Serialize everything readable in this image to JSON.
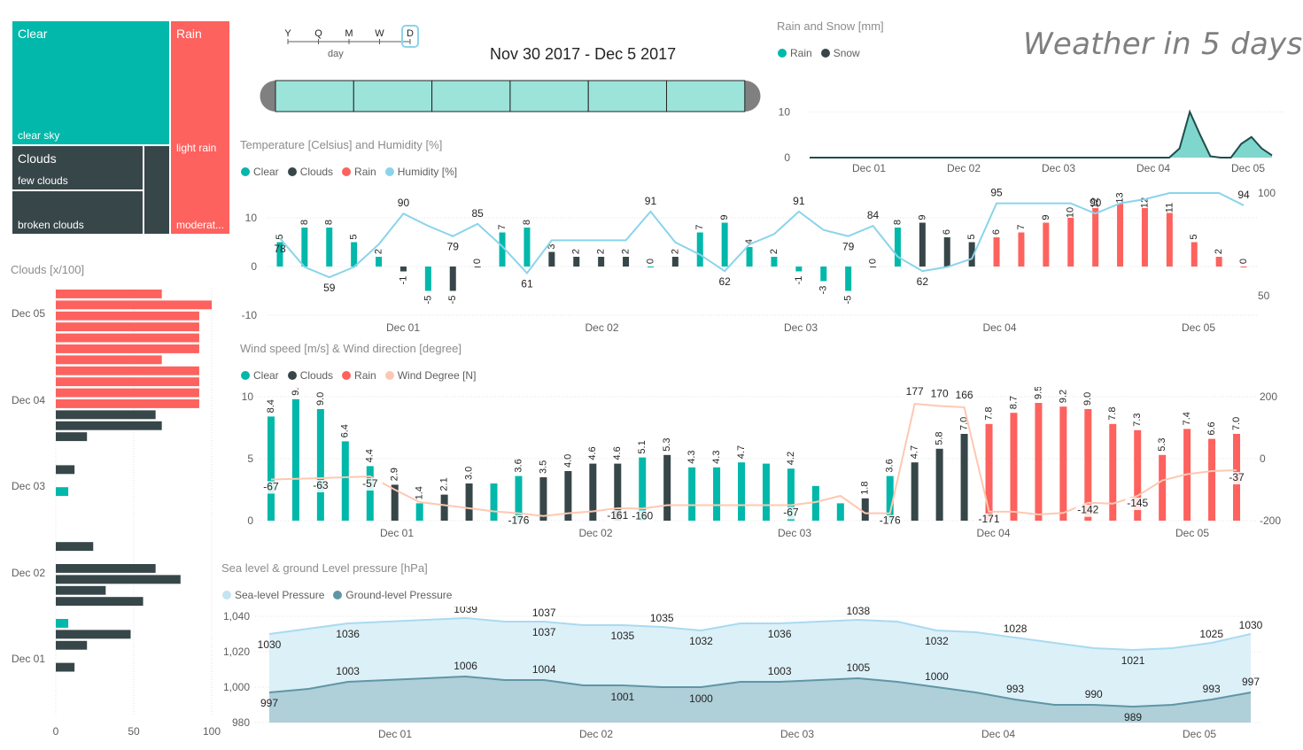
{
  "colors": {
    "clear": "#01b8aa",
    "clouds": "#374649",
    "rain": "#fd625e",
    "humidity": "#8ad4eb",
    "wind": "#fdc8b2",
    "sea": "#c4e4f3",
    "ground": "#5f96a6"
  },
  "header": {
    "title": "Weather in 5 days",
    "date_range": "Nov 30 2017 - Dec 5 2017",
    "slicer": {
      "levels": [
        "Y",
        "Q",
        "M",
        "W",
        "D"
      ],
      "selected": "D",
      "caption": "day"
    }
  },
  "treemap": {
    "clear": {
      "label": "Clear",
      "sub": "clear sky"
    },
    "rain": {
      "label": "Rain",
      "sub1": "light rain",
      "sub2": "moderat..."
    },
    "clouds": {
      "label": "Clouds",
      "sub1": "few clouds",
      "sub2": "broken clouds"
    }
  },
  "rain_snow": {
    "title": "Rain and Snow [mm]",
    "legend": [
      "Rain",
      "Snow"
    ],
    "y_ticks": [
      "10",
      "0"
    ],
    "x_ticks": [
      "Dec 01",
      "Dec 02",
      "Dec 03",
      "Dec 04",
      "Dec 05"
    ]
  },
  "temp": {
    "title": "Temperature [Celsius] and Humidity [%]",
    "legend": [
      "Clear",
      "Clouds",
      "Rain",
      "Humidity [%]"
    ],
    "y_left": [
      "10",
      "0",
      "-10"
    ],
    "y_right": [
      "100",
      "50"
    ],
    "x_ticks": [
      "Dec 01",
      "Dec 02",
      "Dec 03",
      "Dec 04",
      "Dec 05"
    ]
  },
  "wind": {
    "title": "Wind speed [m/s] & Wind direction [degree]",
    "legend": [
      "Clear",
      "Clouds",
      "Rain",
      "Wind Degree [N]"
    ],
    "y_left": [
      "10",
      "5",
      "0"
    ],
    "y_right": [
      "200",
      "0",
      "-200"
    ],
    "x_ticks": [
      "Dec 01",
      "Dec 02",
      "Dec 03",
      "Dec 04",
      "Dec 05"
    ]
  },
  "pressure": {
    "title": "Sea level & ground Level pressure [hPa]",
    "legend": [
      "Sea-level Pressure",
      "Ground-level Pressure"
    ],
    "y_ticks": [
      "1,040",
      "1,020",
      "1,000",
      "980"
    ],
    "x_ticks": [
      "Dec 01",
      "Dec 02",
      "Dec 03",
      "Dec 04",
      "Dec 05"
    ]
  },
  "clouds_bar": {
    "title": "Clouds [x/100]",
    "x_ticks": [
      "0",
      "50",
      "100"
    ],
    "y_ticks": [
      "Dec 05",
      "Dec 04",
      "Dec 03",
      "Dec 02",
      "Dec 01"
    ]
  },
  "chart_data": [
    {
      "type": "area",
      "title": "Rain and Snow [mm]",
      "series": [
        {
          "name": "Rain",
          "values": [
            0,
            0,
            0,
            0,
            0,
            0,
            0,
            0,
            0,
            0,
            0,
            0,
            0,
            0,
            0,
            0,
            0,
            0,
            0,
            0,
            0,
            0,
            0,
            0,
            0,
            0,
            0,
            0,
            0,
            0,
            0,
            0,
            0,
            0,
            0,
            0,
            0,
            0,
            0,
            0,
            0,
            0,
            0,
            0,
            0,
            0,
            0,
            0,
            0,
            0,
            0,
            0,
            0,
            0,
            0,
            0,
            0,
            0,
            0,
            0,
            0,
            0,
            0,
            0,
            0,
            0,
            0,
            0,
            0,
            0,
            0,
            0,
            0,
            0,
            0,
            0,
            0,
            0,
            0,
            0,
            0,
            0,
            0,
            0,
            0,
            0,
            0,
            0,
            0,
            0,
            0,
            0,
            0,
            0,
            0,
            0,
            0,
            0,
            0,
            0,
            0,
            0,
            0,
            0,
            0,
            0,
            0,
            0,
            0,
            0,
            0,
            0,
            0,
            0,
            0,
            0,
            0,
            0,
            0,
            0,
            0,
            0,
            0,
            0,
            0,
            0,
            0,
            0,
            0,
            0,
            0,
            0,
            0,
            0,
            0,
            0,
            0,
            0,
            0
          ]
        },
        {
          "name": "Snow",
          "values": []
        }
      ],
      "points": [
        [
          0,
          0
        ],
        [
          35,
          0
        ],
        [
          36,
          2
        ],
        [
          37,
          10
        ],
        [
          38,
          5
        ],
        [
          39,
          0.3
        ],
        [
          40,
          0
        ],
        [
          41,
          0
        ],
        [
          42,
          3
        ],
        [
          43,
          4.5
        ],
        [
          44,
          2
        ],
        [
          45,
          0.5
        ]
      ]
    },
    {
      "type": "bar",
      "title": "Temperature [Celsius] and Humidity [%]",
      "temps": [
        5,
        8,
        8,
        5,
        2,
        -1,
        -5,
        -5,
        0,
        7,
        8,
        3,
        2,
        2,
        2,
        0,
        2,
        7,
        9,
        4,
        2,
        -1,
        -3,
        -5,
        0,
        8,
        9,
        6,
        5,
        6,
        7,
        9,
        10,
        12,
        13,
        12,
        11,
        5,
        2,
        0
      ],
      "weather": [
        "clear",
        "clear",
        "clear",
        "clear",
        "clear",
        "clouds",
        "clear",
        "clouds",
        "clouds",
        "clear",
        "clear",
        "clouds",
        "clouds",
        "clouds",
        "clouds",
        "clear",
        "clouds",
        "clear",
        "clear",
        "clear",
        "clear",
        "clear",
        "clear",
        "clear",
        "clouds",
        "clear",
        "clouds",
        "clouds",
        "clouds",
        "rain",
        "rain",
        "rain",
        "rain",
        "rain",
        "rain",
        "rain",
        "rain",
        "rain",
        "rain",
        "rain"
      ],
      "humidity": [
        78,
        64,
        59,
        64,
        75,
        90,
        84,
        79,
        85,
        74,
        61,
        77,
        77,
        77,
        77,
        91,
        76,
        70,
        62,
        75,
        80,
        91,
        82,
        79,
        84,
        69,
        62,
        64,
        68,
        95,
        95,
        95,
        95,
        90,
        95,
        97,
        100,
        100,
        100,
        94
      ],
      "humidity_labels": {
        "0": "78",
        "2": "59",
        "5": "90",
        "7": "79",
        "8": "85",
        "10": "61",
        "15": "91",
        "18": "62",
        "21": "91",
        "23": "79",
        "24": "84",
        "26": "62",
        "29": "95",
        "33": "90",
        "39": "94"
      },
      "ylim": [
        -10,
        15
      ],
      "y2lim": [
        40,
        105
      ]
    },
    {
      "type": "bar",
      "title": "Wind speed [m/s] & Wind direction [degree]",
      "speeds": [
        8.4,
        9.8,
        9.0,
        6.4,
        4.4,
        2.9,
        1.4,
        2.1,
        3.0,
        3.0,
        3.6,
        3.5,
        4.0,
        4.6,
        4.6,
        5.1,
        5.3,
        4.3,
        4.3,
        4.7,
        4.6,
        4.2,
        2.8,
        1.4,
        1.8,
        3.6,
        4.7,
        5.8,
        7.0,
        7.8,
        8.7,
        9.5,
        9.2,
        9.0,
        7.8,
        7.3,
        5.3,
        7.4,
        6.6,
        7.0
      ],
      "weather": [
        "clear",
        "clear",
        "clear",
        "clear",
        "clear",
        "clouds",
        "clear",
        "clouds",
        "clouds",
        "clear",
        "clear",
        "clouds",
        "clouds",
        "clouds",
        "clouds",
        "clear",
        "clouds",
        "clear",
        "clear",
        "clear",
        "clear",
        "clear",
        "clear",
        "clear",
        "clouds",
        "clear",
        "clouds",
        "clouds",
        "clouds",
        "rain",
        "rain",
        "rain",
        "rain",
        "rain",
        "rain",
        "rain",
        "rain",
        "rain",
        "rain",
        "rain"
      ],
      "speed_labels": [
        "8.4",
        "9.8",
        "9.0",
        "6.4",
        "4.4",
        "2.9",
        "1.4",
        "2.1",
        "3.0",
        "",
        "3.6",
        "3.5",
        "4.0",
        "4.6",
        "4.6",
        "5.1",
        "5.3",
        "4.3",
        "4.3",
        "4.7",
        "",
        "4.2",
        "",
        "",
        "1.8",
        "3.6",
        "4.7",
        "5.8",
        "7.0",
        "7.8",
        "8.7",
        "9.5",
        "9.2",
        "9.0",
        "7.8",
        "7.3",
        "5.3",
        "7.4",
        "6.6",
        "7.0"
      ],
      "degree": [
        -67,
        -65,
        -63,
        -60,
        -57,
        -100,
        -140,
        -150,
        -160,
        -170,
        -176,
        -185,
        -176,
        -170,
        -160,
        -161,
        -150,
        -150,
        -150,
        -150,
        -150,
        -150,
        -140,
        -120,
        -176,
        -176,
        177,
        170,
        166,
        -171,
        -171,
        -180,
        -175,
        -142,
        -145,
        -120,
        -70,
        -50,
        -40,
        -37
      ],
      "degree_labels": {
        "0": "-67",
        "2": "-63",
        "4": "-57",
        "10": "-176",
        "14": "-161",
        "15": "-160",
        "21": "-67",
        "25": "-176",
        "26": "177",
        "27": "170",
        "28": "166",
        "29": "-171",
        "33": "-142",
        "35": "-145",
        "39": "-37"
      },
      "ylim": [
        0,
        10
      ],
      "y2lim": [
        -200,
        200
      ]
    },
    {
      "type": "area",
      "title": "Sea level & ground Level pressure [hPa]",
      "sea": [
        1030,
        1033,
        1036,
        1037,
        1038,
        1039,
        1037,
        1037,
        1035,
        1035,
        1034,
        1032,
        1036,
        1036,
        1037,
        1038,
        1037,
        1032,
        1031,
        1028,
        1025,
        1022,
        1021,
        1022,
        1025,
        1030
      ],
      "ground": [
        997,
        999,
        1003,
        1004,
        1005,
        1006,
        1004,
        1004,
        1001,
        1001,
        1000,
        1000,
        1003,
        1003,
        1004,
        1005,
        1003,
        1000,
        997,
        993,
        990,
        990,
        989,
        990,
        993,
        997
      ],
      "sea_labels": {
        "0": "1030",
        "2": "1036",
        "5": "1039",
        "7": "1037",
        "9": "1035",
        "10": "1035",
        "11": "1032",
        "13": "1036",
        "15": "1038",
        "17": "1032",
        "19": "1028",
        "22": "1021",
        "24": "1025",
        "25": "1030"
      },
      "sea_labels2": {
        "7": "1037"
      },
      "ground_labels": {
        "0": "997",
        "2": "1003",
        "5": "1006",
        "7": "1004",
        "9": "1001",
        "11": "1000",
        "13": "1003",
        "15": "1005",
        "17": "1000",
        "19": "993",
        "21": "990",
        "22": "989",
        "24": "993",
        "25": "997"
      },
      "ground_labels_below": {
        "9": "1001",
        "11": "1000"
      },
      "ylim": [
        980,
        1040
      ]
    },
    {
      "type": "bar",
      "title": "Clouds [x/100]",
      "rows": [
        {
          "v": 68,
          "c": "rain"
        },
        {
          "v": 100,
          "c": "rain"
        },
        {
          "v": 92,
          "c": "rain"
        },
        {
          "v": 92,
          "c": "rain"
        },
        {
          "v": 92,
          "c": "rain"
        },
        {
          "v": 92,
          "c": "rain"
        },
        {
          "v": 68,
          "c": "rain"
        },
        {
          "v": 92,
          "c": "rain"
        },
        {
          "v": 92,
          "c": "rain"
        },
        {
          "v": 92,
          "c": "rain"
        },
        {
          "v": 92,
          "c": "rain"
        },
        {
          "v": 64,
          "c": "clouds"
        },
        {
          "v": 68,
          "c": "clouds"
        },
        {
          "v": 20,
          "c": "clouds"
        },
        {
          "v": 12,
          "c": "clouds"
        },
        {
          "v": 8,
          "c": "clear"
        },
        {
          "v": 24,
          "c": "clouds"
        },
        {
          "v": 64,
          "c": "clouds"
        },
        {
          "v": 80,
          "c": "clouds"
        },
        {
          "v": 32,
          "c": "clouds"
        },
        {
          "v": 56,
          "c": "clouds"
        },
        {
          "v": 8,
          "c": "clear"
        },
        {
          "v": 48,
          "c": "clouds"
        },
        {
          "v": 20,
          "c": "clouds"
        },
        {
          "v": 12,
          "c": "clouds"
        }
      ],
      "xlim": [
        0,
        100
      ]
    }
  ]
}
